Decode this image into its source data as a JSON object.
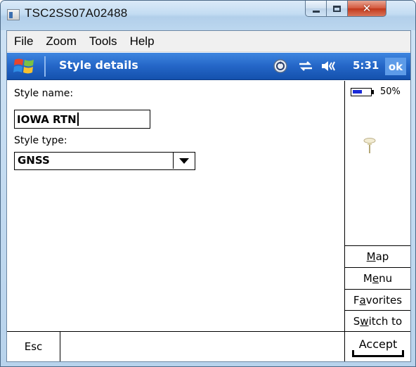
{
  "window": {
    "title": "TSC2SS07A02488"
  },
  "menubar": {
    "items": [
      "File",
      "Zoom",
      "Tools",
      "Help"
    ]
  },
  "navbar": {
    "title": "Style details",
    "time": "5:31",
    "ok_label": "ok",
    "icons": [
      "start-flag-icon",
      "sync-icon",
      "connectivity-icon",
      "speaker-icon"
    ]
  },
  "form": {
    "style_name_label": "Style name:",
    "style_name_value": "IOWA RTN",
    "style_type_label": "Style type:",
    "style_type_value": "GNSS"
  },
  "side_panel": {
    "battery_percent": "50%",
    "battery_level": 0.5,
    "status_icon": "gnss-receiver-icon",
    "buttons": {
      "map": {
        "pre": "",
        "ul": "M",
        "post": "ap"
      },
      "menu": {
        "pre": "M",
        "ul": "e",
        "post": "nu"
      },
      "favorites": {
        "pre": "F",
        "ul": "a",
        "post": "vorites"
      },
      "switch_to": {
        "pre": "S",
        "ul": "w",
        "post": "itch to"
      }
    }
  },
  "bottom": {
    "esc_label": "Esc",
    "accept_label": "Accept"
  },
  "colors": {
    "nav_blue": "#2466c7",
    "battery_blue": "#1a2ad8"
  }
}
